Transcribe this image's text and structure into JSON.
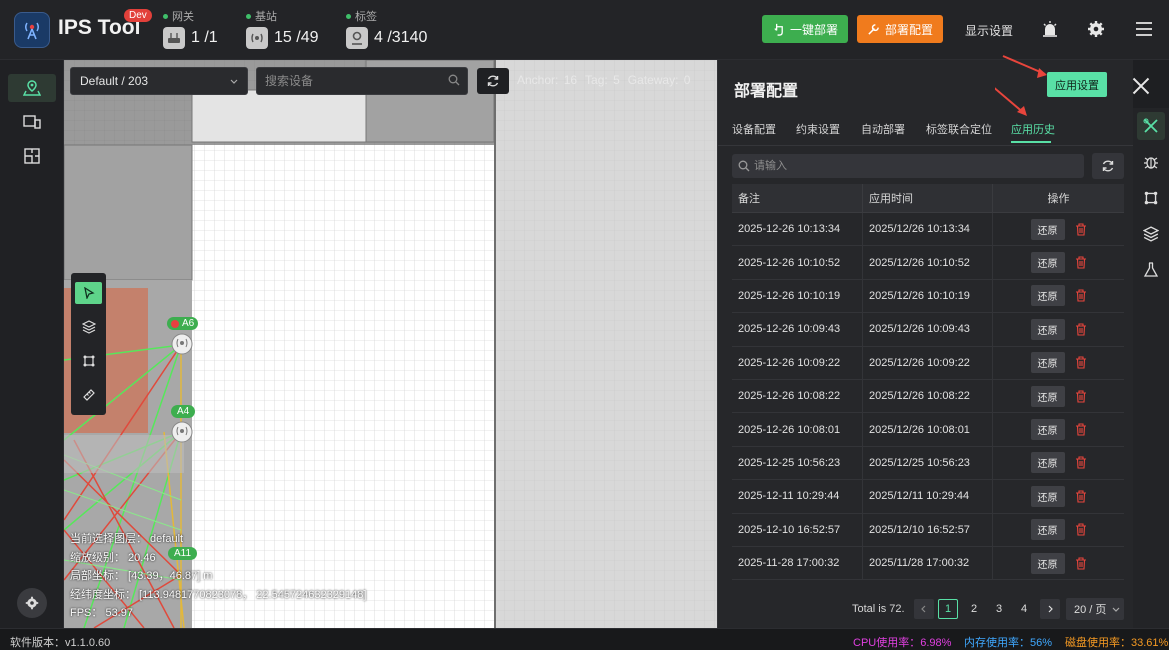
{
  "header": {
    "app_title": "IPS Tool",
    "dev_badge": "Dev",
    "stats": [
      {
        "label": "网关",
        "value": "1 /1"
      },
      {
        "label": "基站",
        "value": "15 /49"
      },
      {
        "label": "标签",
        "value": "4 /3140"
      }
    ],
    "deploy_button": "一键部署",
    "config_button": "部署配置",
    "display_settings": "显示设置"
  },
  "map": {
    "floor": "Default / 203",
    "search_placeholder": "搜索设备",
    "anchor_count": "Anchor: 16",
    "tag_count": "Tag: 5",
    "gateway_count": "Gateway: 0",
    "anchors": [
      "A6",
      "A4",
      "A11"
    ],
    "info": {
      "layer": "当前选择图层： default",
      "zoom": "缩放级别： 20.46",
      "local_coord": "局部坐标： [43.39，46.87] m",
      "lnglat": "经纬度坐标： [113.9481770823078， 22.545724632329148]",
      "fps": "FPS： 53.97"
    }
  },
  "panel": {
    "title": "部署配置",
    "apply_button": "应用设置",
    "tabs": [
      "设备配置",
      "约束设置",
      "自动部署",
      "标签联合定位",
      "应用历史"
    ],
    "active_tab": "应用历史",
    "search_placeholder": "请输入",
    "columns": [
      "备注",
      "应用时间",
      "操作"
    ],
    "restore_label": "还原",
    "rows": [
      {
        "note": "2025-12-26 10:13:34",
        "time": "2025/12/26 10:13:34"
      },
      {
        "note": "2025-12-26 10:10:52",
        "time": "2025/12/26 10:10:52"
      },
      {
        "note": "2025-12-26 10:10:19",
        "time": "2025/12/26 10:10:19"
      },
      {
        "note": "2025-12-26 10:09:43",
        "time": "2025/12/26 10:09:43"
      },
      {
        "note": "2025-12-26 10:09:22",
        "time": "2025/12/26 10:09:22"
      },
      {
        "note": "2025-12-26 10:08:22",
        "time": "2025/12/26 10:08:22"
      },
      {
        "note": "2025-12-26 10:08:01",
        "time": "2025/12/26 10:08:01"
      },
      {
        "note": "2025-12-25 10:56:23",
        "time": "2025/12/25 10:56:23"
      },
      {
        "note": "2025-12-11 10:29:44",
        "time": "2025/12/11 10:29:44"
      },
      {
        "note": "2025-12-10 16:52:57",
        "time": "2025/12/10 16:52:57"
      },
      {
        "note": "2025-11-28 17:00:32",
        "time": "2025/11/28 17:00:32"
      }
    ],
    "pagination": {
      "total": "Total is 72.",
      "pages": [
        "1",
        "2",
        "3",
        "4"
      ],
      "current": "1",
      "page_size": "20 / 页"
    }
  },
  "footer": {
    "version": "软件版本：v1.1.0.60",
    "cpu": "CPU使用率：6.98%",
    "memory": "内存使用率：56%",
    "disk": "磁盘使用率：33.61%"
  },
  "colors": {
    "accent": "#59e0a6",
    "green_button": "#3dae4f",
    "orange_button": "#f07b1d",
    "cpu": "#e040e0",
    "memory": "#3fa8ff",
    "disk": "#f59a23",
    "arrow": "#e8453c"
  }
}
